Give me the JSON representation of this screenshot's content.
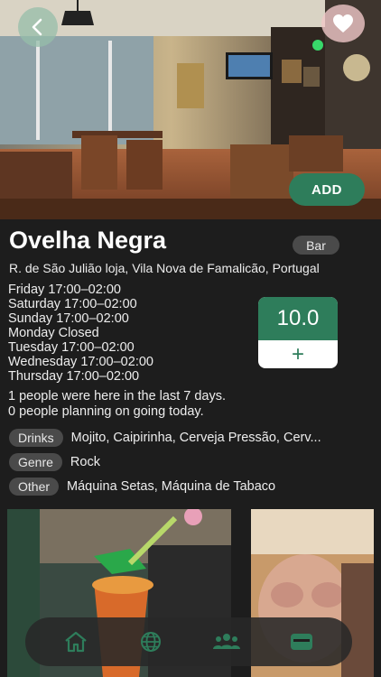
{
  "venue": {
    "name": "Ovelha Negra",
    "type": "Bar",
    "address": "R. de São Julião loja, Vila Nova de Famalicão, Portugal",
    "hours": [
      "Friday 17:00–02:00",
      "Saturday 17:00–02:00",
      "Sunday 17:00–02:00",
      "Monday Closed",
      "Tuesday 17:00–02:00",
      "Wednesday 17:00–02:00",
      "Thursday 17:00–02:00"
    ],
    "rating": "10.0",
    "rating_add_glyph": "+",
    "visits": "1 people were here in the last 7 days.",
    "planning": "0 people planning on going today."
  },
  "actions": {
    "add_label": "ADD"
  },
  "tags": {
    "drinks": {
      "label": "Drinks",
      "value": "Mojito, Caipirinha, Cerveja Pressão,  Cerv..."
    },
    "genre": {
      "label": "Genre",
      "value": "Rock"
    },
    "other": {
      "label": "Other",
      "value": "Máquina Setas,  Máquina de Tabaco"
    }
  },
  "nav": {
    "items": [
      "home-icon",
      "globe-icon",
      "people-icon",
      "wallet-icon"
    ]
  },
  "colors": {
    "accent": "#2e7d5b",
    "background": "#1d1d1d",
    "tag": "#4a4a4a"
  }
}
